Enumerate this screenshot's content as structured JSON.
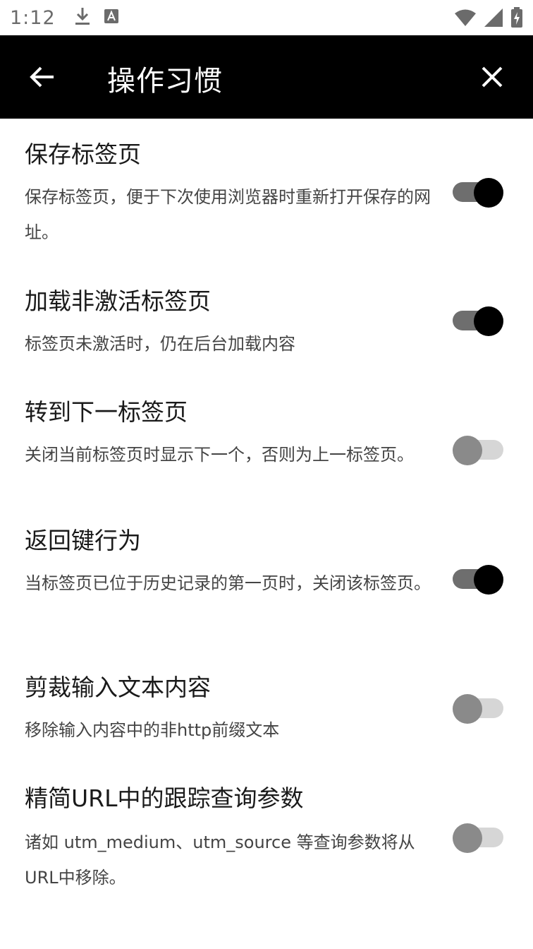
{
  "status_bar": {
    "time": "1:12"
  },
  "app_bar": {
    "title": "操作习惯"
  },
  "settings": [
    {
      "title": "保存标签页",
      "description": "保存标签页，便于下次使用浏览器时重新打开保存的网址。",
      "enabled": true
    },
    {
      "title": "加载非激活标签页",
      "description": "标签页未激活时，仍在后台加载内容",
      "enabled": true
    },
    {
      "title": "转到下一标签页",
      "description": "关闭当前标签页时显示下一个，否则为上一标签页。",
      "enabled": false
    },
    {
      "title": "返回键行为",
      "description": "当标签页已位于历史记录的第一页时，关闭该标签页。",
      "enabled": true
    },
    {
      "title": "剪裁输入文本内容",
      "description": "移除输入内容中的非http前缀文本",
      "enabled": false
    },
    {
      "title": "精简URL中的跟踪查询参数",
      "description": "诸如 utm_medium、utm_source 等查询参数将从URL中移除。",
      "enabled": false
    }
  ],
  "icons": {
    "back": "arrow-left-icon",
    "close": "close-icon",
    "download": "download-icon",
    "notification": "a-box-icon",
    "wifi": "wifi-icon",
    "signal": "signal-icon",
    "battery": "battery-charging-icon"
  }
}
